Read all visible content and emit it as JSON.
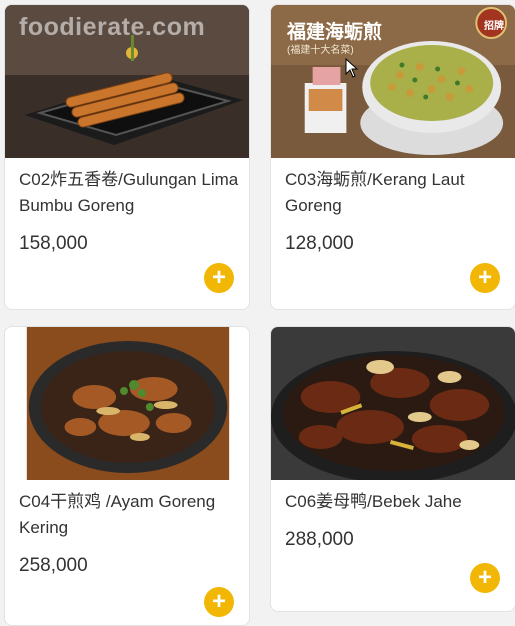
{
  "watermark": "foodierate.com",
  "accent_color": "#f2b705",
  "items": [
    {
      "code_name": "C02炸五香卷/Gulungan Lima Bumbu Goreng",
      "price": "158,000",
      "add_icon": "plus-icon",
      "add_glyph": "+"
    },
    {
      "code_name": "C03海蛎煎/Kerang Laut Goreng",
      "price": "128,000",
      "add_icon": "plus-icon",
      "add_glyph": "+",
      "photo_text": {
        "title": "福建海蛎煎",
        "subtitle": "(福建十大名菜)",
        "badge": "招牌"
      }
    },
    {
      "code_name": "C04干煎鸡 /Ayam Goreng Kering",
      "price": "258,000",
      "add_icon": "plus-icon",
      "add_glyph": "+"
    },
    {
      "code_name": "C06姜母鸭/Bebek Jahe",
      "price": "288,000",
      "add_icon": "plus-icon",
      "add_glyph": "+"
    }
  ]
}
